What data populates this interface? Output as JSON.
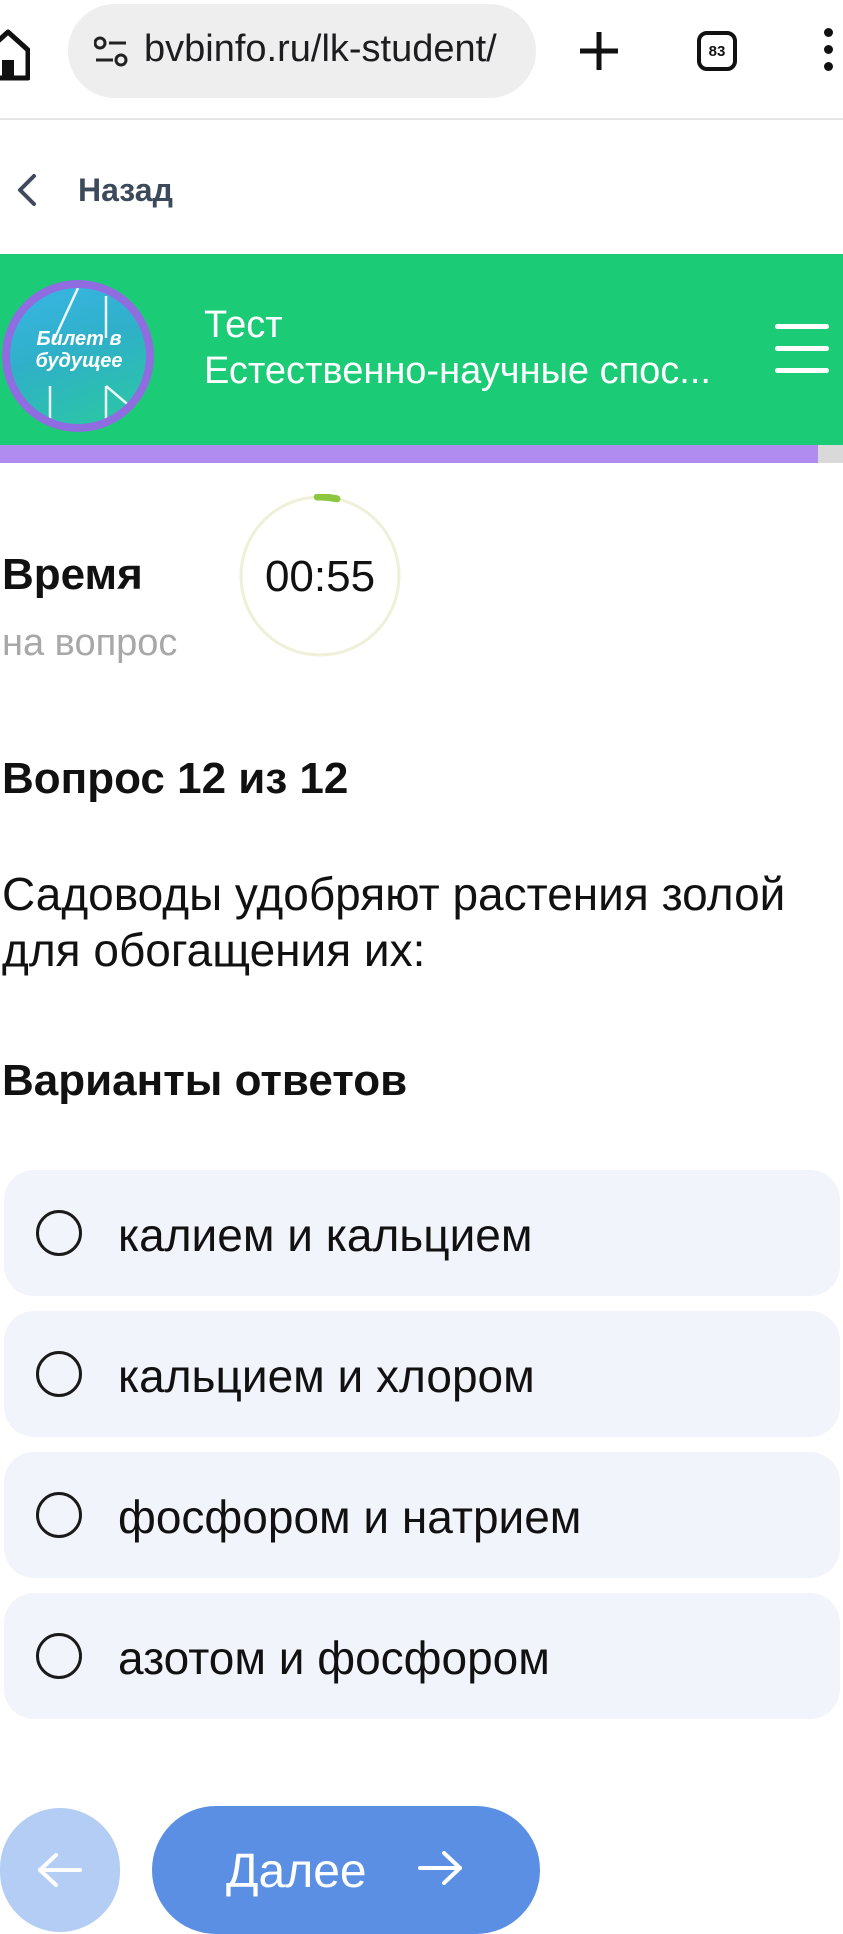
{
  "browser": {
    "url": "bvbinfo.ru/lk-student/",
    "tab_count": "83"
  },
  "nav": {
    "back_label": "Назад"
  },
  "header": {
    "logo_text_line1": "Билет в",
    "logo_text_line2": "будущее",
    "title": "Тест",
    "subtitle": "Естественно-научные спос...",
    "progress_fraction": 0.97,
    "accent_color": "#1ccb76",
    "progress_color": "#b08cf0"
  },
  "timer": {
    "label": "Время",
    "sublabel": "на вопрос",
    "value": "00:55",
    "remaining_fraction": 0.04
  },
  "question": {
    "number_text": "Вопрос 12 из 12",
    "text": "Садоводы удобряют растения золой для обогащения их:"
  },
  "answers": {
    "title": "Варианты ответов",
    "options": [
      {
        "label": "калием и кальцием"
      },
      {
        "label": "кальцием и хлором"
      },
      {
        "label": "фосфором и натрием"
      },
      {
        "label": "азотом и фосфором"
      }
    ]
  },
  "footer": {
    "next_label": "Далее"
  },
  "icons": {
    "home": "home-icon",
    "site_settings": "site-settings-icon",
    "new_tab": "plus-icon",
    "menu": "more-vert-icon",
    "back": "chevron-left-icon",
    "hamburger": "hamburger-menu-icon",
    "prev": "arrow-left-icon",
    "next": "arrow-right-icon"
  }
}
